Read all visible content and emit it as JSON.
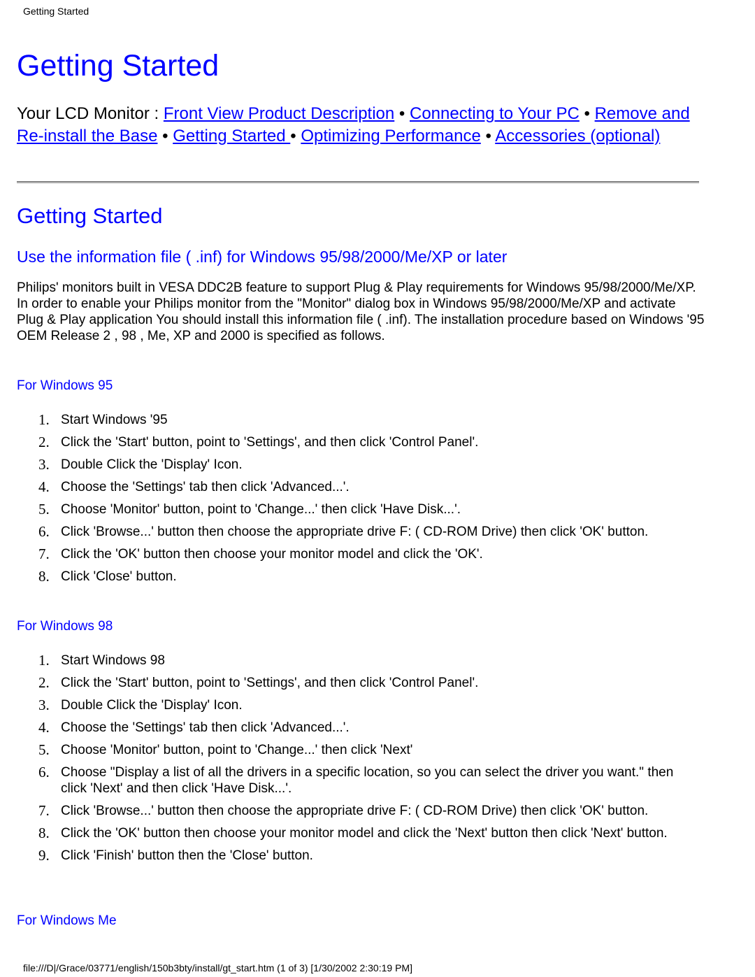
{
  "header": {
    "running_title": "Getting Started"
  },
  "title": "Getting Started",
  "nav": {
    "prefix": "Your LCD Monitor   : ",
    "separator": " • ",
    "links": [
      {
        "label": "Front View Product Description"
      },
      {
        "label": "Connecting to Your PC"
      },
      {
        "label": "Remove and Re-install the Base"
      },
      {
        "label": "Getting Started "
      },
      {
        "label": "Optimizing Performance"
      },
      {
        "label": "Accessories (optional)"
      }
    ]
  },
  "section": {
    "title": "Getting Started",
    "subheading": "Use the information file ( .inf) for Windows 95/98/2000/Me/XP or later",
    "intro": "Philips' monitors built in VESA DDC2B feature to support Plug & Play requirements for Windows 95/98/2000/Me/XP. In order to enable your Philips monitor from the \"Monitor\" dialog box in Windows 95/98/2000/Me/XP and activate Plug & Play application You should install this information file ( .inf). The installation procedure based on Windows '95 OEM Release 2 , 98 , Me, XP and 2000 is specified as follows."
  },
  "win95": {
    "heading": "For Windows 95",
    "steps": [
      {
        "num": "1.",
        "text": "Start Windows '95"
      },
      {
        "num": "2.",
        "text": "Click the 'Start' button, point to 'Settings', and then click 'Control Panel'."
      },
      {
        "num": "3.",
        "text": "Double Click the 'Display' Icon."
      },
      {
        "num": "4.",
        "text": "Choose the 'Settings' tab then click 'Advanced...'."
      },
      {
        "num": "5.",
        "text": "Choose 'Monitor' button, point to 'Change...' then click 'Have Disk...'."
      },
      {
        "num": "6.",
        "text": "Click 'Browse...' button then choose the appropriate drive F: ( CD-ROM Drive) then click 'OK' button."
      },
      {
        "num": "7.",
        "text": "Click the 'OK' button then choose your monitor model and click the 'OK'."
      },
      {
        "num": "8.",
        "text": "Click 'Close' button."
      }
    ]
  },
  "win98": {
    "heading": "For Windows 98",
    "steps": [
      {
        "num": "1.",
        "text": "Start Windows 98"
      },
      {
        "num": "2.",
        "text": "Click the 'Start' button, point to 'Settings', and then click 'Control Panel'."
      },
      {
        "num": "3.",
        "text": "Double Click the 'Display' Icon."
      },
      {
        "num": "4.",
        "text": "Choose the 'Settings' tab then click 'Advanced...'."
      },
      {
        "num": "5.",
        "text": "Choose 'Monitor' button, point to 'Change...' then click 'Next'"
      },
      {
        "num": "6.",
        "text": "Choose \"Display a list of all the drivers in a specific location, so you can select the driver you want.\" then click 'Next' and then click 'Have Disk...'."
      },
      {
        "num": "7.",
        "text": "Click 'Browse...' button then choose the appropriate drive F: ( CD-ROM Drive) then click 'OK' button."
      },
      {
        "num": "8.",
        "text": "Click the 'OK' button then choose your monitor model and click the 'Next' button then click 'Next' button."
      },
      {
        "num": "9.",
        "text": "Click 'Finish' button then the 'Close' button."
      }
    ]
  },
  "winme": {
    "heading": "For Windows Me"
  },
  "footer": {
    "text": "file:///D|/Grace/03771/english/150b3bty/install/gt_start.htm (1 of 3) [1/30/2002 2:30:19 PM]"
  },
  "colors": {
    "link": "#0000ff",
    "heading": "#0000ff",
    "text": "#000000"
  }
}
